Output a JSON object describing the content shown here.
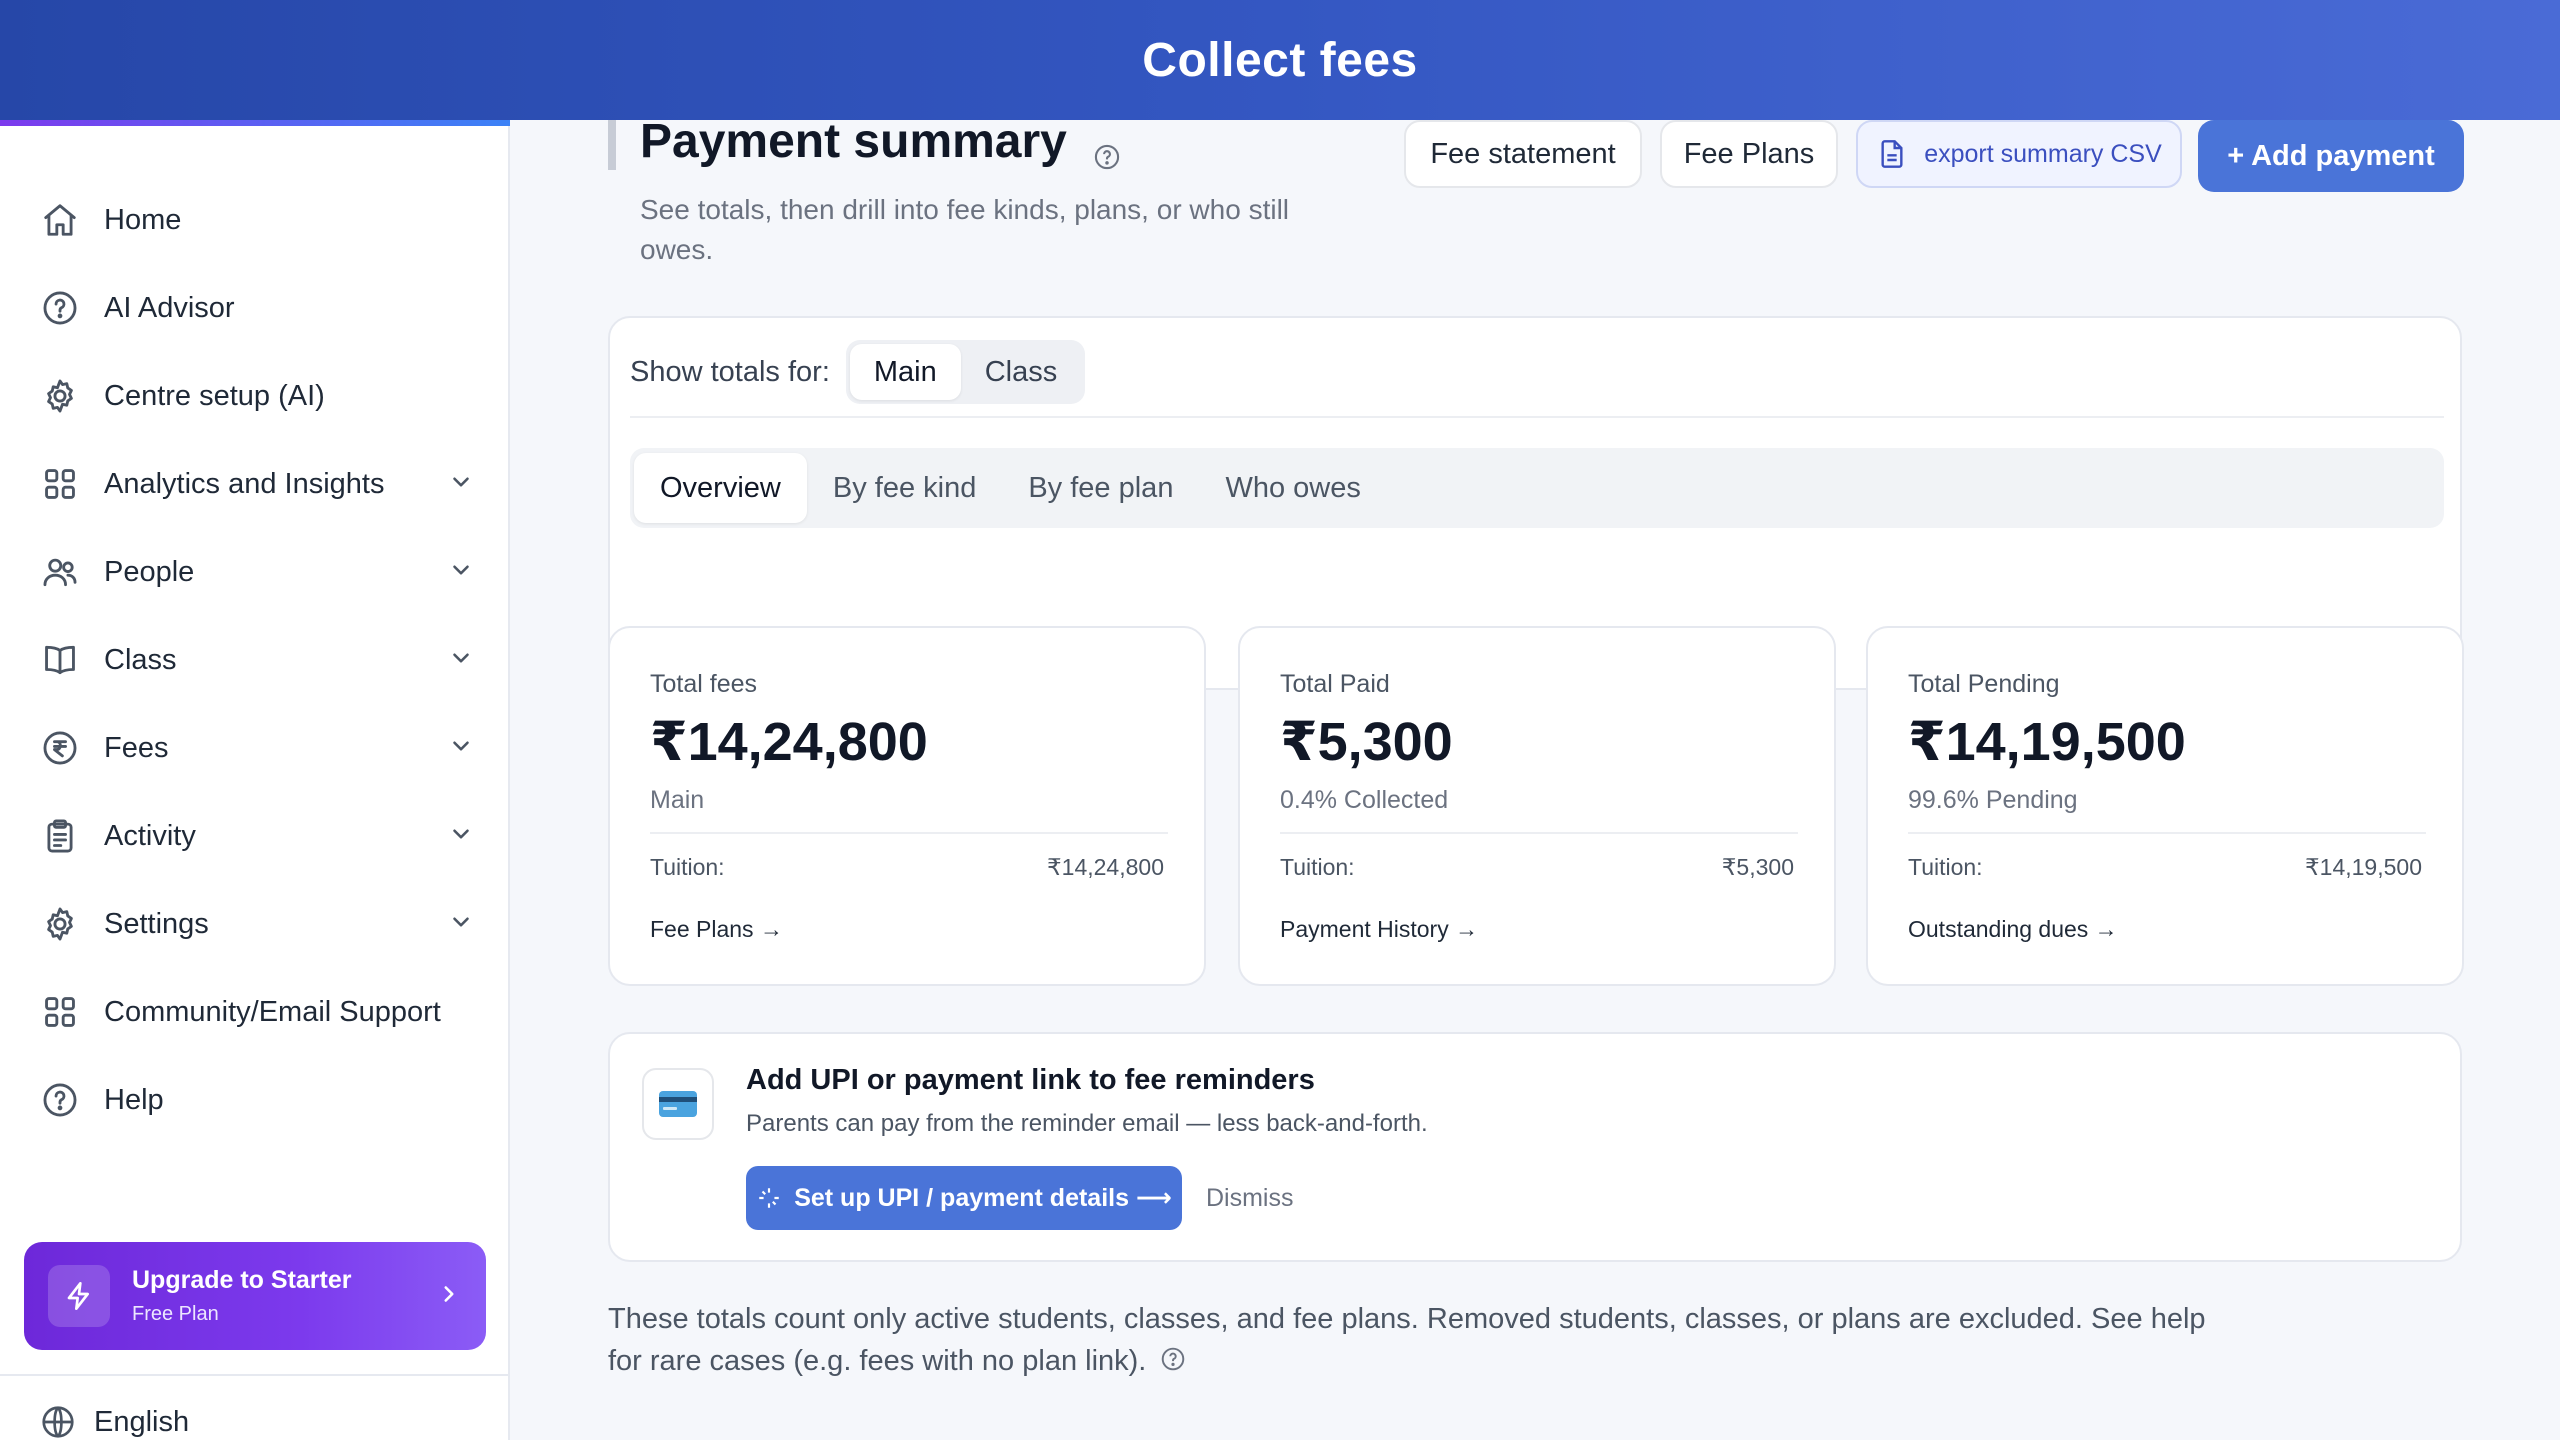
{
  "header": {
    "title": "Collect fees"
  },
  "sidebar": {
    "items": [
      {
        "label": "Home",
        "icon": "home-icon",
        "chevron": false
      },
      {
        "label": "AI Advisor",
        "icon": "help-circle-icon",
        "chevron": false
      },
      {
        "label": "Centre setup (AI)",
        "icon": "gear-icon",
        "chevron": false
      },
      {
        "label": "Analytics and Insights",
        "icon": "grid-icon",
        "chevron": true
      },
      {
        "label": "People",
        "icon": "users-icon",
        "chevron": true
      },
      {
        "label": "Class",
        "icon": "book-icon",
        "chevron": true
      },
      {
        "label": "Fees",
        "icon": "rupee-icon",
        "chevron": true
      },
      {
        "label": "Activity",
        "icon": "clipboard-icon",
        "chevron": true
      },
      {
        "label": "Settings",
        "icon": "gear-icon",
        "chevron": true
      },
      {
        "label": "Community/Email Support",
        "icon": "grid-icon",
        "chevron": false
      },
      {
        "label": "Help",
        "icon": "help-circle-icon",
        "chevron": false
      }
    ],
    "upgrade": {
      "title": "Upgrade to Starter",
      "plan": "Free Plan"
    },
    "language": "English"
  },
  "page": {
    "title": "Payment summary",
    "subtitle": "See totals, then drill into fee kinds, plans, or who still owes."
  },
  "toolbar": {
    "fee_statement": "Fee statement",
    "fee_plans": "Fee Plans",
    "export_csv": "export summary CSV",
    "add_payment": "+ Add payment"
  },
  "filters": {
    "label": "Show totals for:",
    "options": [
      "Main",
      "Class"
    ],
    "selected": "Main"
  },
  "tabs": [
    "Overview",
    "By fee kind",
    "By fee plan",
    "Who owes"
  ],
  "active_tab": "Overview",
  "stats": [
    {
      "label": "Total fees",
      "value": "₹14,24,800",
      "sub": "Main",
      "row_label": "Tuition:",
      "row_value": "₹14,24,800",
      "link": "Fee Plans →"
    },
    {
      "label": "Total Paid",
      "value": "₹5,300",
      "sub": "0.4% Collected",
      "row_label": "Tuition:",
      "row_value": "₹5,300",
      "link": "Payment History →"
    },
    {
      "label": "Total Pending",
      "value": "₹14,19,500",
      "sub": "99.6% Pending",
      "row_label": "Tuition:",
      "row_value": "₹14,19,500",
      "link": "Outstanding dues →"
    }
  ],
  "upi": {
    "title": "Add UPI or payment link to fee reminders",
    "description": "Parents can pay from the reminder email — less back-and-forth.",
    "button": "Set up UPI / payment details ⟶",
    "dismiss": "Dismiss"
  },
  "footnote": "These totals count only active students, classes, and fee plans. Removed students, classes, or plans are excluded. See help for rare cases (e.g. fees with no plan link).",
  "colors": {
    "primary": "#4a74d8",
    "header": "#3457c2",
    "upgrade": "#7c3aed"
  }
}
